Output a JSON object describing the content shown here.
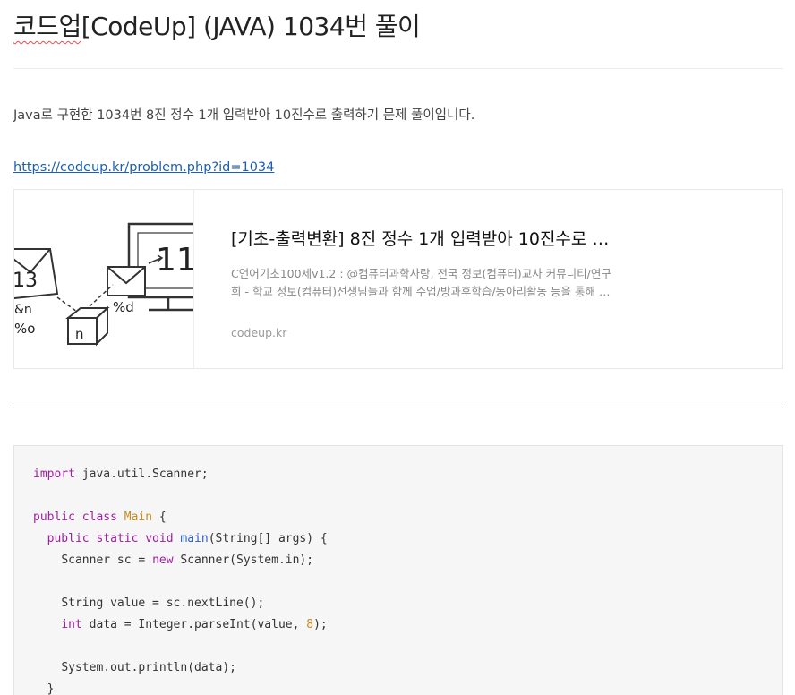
{
  "post": {
    "title_prefix": "코드업",
    "title_rest": "[CodeUp] (JAVA) 1034번 풀이",
    "intro": "Java로 구현한 1034번 8진 정수 1개 입력받아 10진수로 출력하기 문제 풀이입니다.",
    "link": "https://codeup.kr/problem.php?id=1034"
  },
  "card": {
    "title": "[기초-출력변환] 8진 정수 1개 입력받아 10진수로 …",
    "desc_line1": "C언어기초100제v1.2 : @컴퓨터과학사랑, 전국 정보(컴퓨터)교사 커뮤니티/연구",
    "desc_line2": "회 - 학교 정보(컴퓨터)선생님들과 함께 수업/방과후학습/동아리활동 등을 통해 …",
    "domain": "codeup.kr",
    "thumb": {
      "text_13": "13",
      "text_n_amp": "&n",
      "text_pct_o": "%o",
      "text_n": "n",
      "text_pct_d": "%d",
      "text_11": "11"
    }
  },
  "code": {
    "l1_kw": "import",
    "l1_rest": " java.util.Scanner;",
    "l3_kw": "public class",
    "l3_cls": "Main",
    "l3_rest": " {",
    "l4_kw": "public static void",
    "l4_fn": "main",
    "l4_rest": "(String[] args) {",
    "l5_a": "Scanner sc = ",
    "l5_kw": "new",
    "l5_b": " Scanner(System.in);",
    "l7": "String value = sc.nextLine();",
    "l8_kw": "int",
    "l8_a": " data = Integer.parseInt(value, ",
    "l8_num": "8",
    "l8_b": ");",
    "l10": "System.out.println(data);",
    "l11": "}"
  }
}
